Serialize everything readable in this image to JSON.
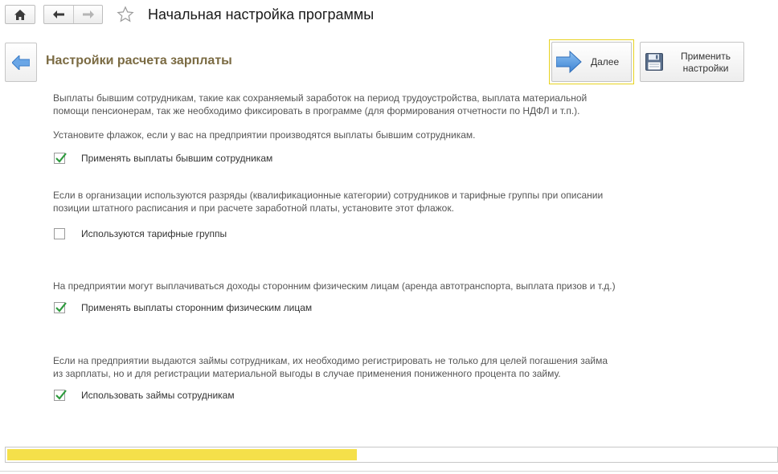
{
  "window": {
    "title": "Начальная настройка программы"
  },
  "header": {
    "section_title": "Настройки расчета зарплаты",
    "next_label": "Далее",
    "apply_label_line1": "Применить",
    "apply_label_line2": "настройки"
  },
  "sections": [
    {
      "text_lines": [
        "Выплаты бывшим сотрудникам, такие как сохраняемый заработок на период трудоустройства, выплата материальной",
        "помощи пенсионерам, так же необходимо фиксировать в программе (для формирования отчетности по НДФЛ и т.п.)."
      ],
      "hint": "Установите флажок, если у вас на предприятии производятся выплаты бывшим сотрудникам.",
      "checkbox_label": "Применять выплаты бывшим сотрудникам",
      "checked": true
    },
    {
      "text_lines": [
        "Если в организации используются разряды (квалификационные категории) сотрудников и тарифные группы при описании",
        "позиции штатного расписания и при расчете заработной платы, установите этот флажок."
      ],
      "checkbox_label": "Используются тарифные группы",
      "checked": false
    },
    {
      "text_lines": [
        "На предприятии могут выплачиваться доходы сторонним физическим лицам (аренда автотранспорта, выплата призов и т.д.)"
      ],
      "checkbox_label": "Применять выплаты сторонним физическим лицам",
      "checked": true
    },
    {
      "text_lines": [
        "Если на предприятии выдаются займы сотрудникам, их необходимо регистрировать не только для целей погашения займа",
        "из зарплаты, но и для регистрации материальной выгоды в случае применения пониженного процента по займу."
      ],
      "checkbox_label": "Использовать займы сотрудникам",
      "checked": true
    }
  ],
  "progress": {
    "fraction": 0.455
  },
  "colors": {
    "accent_title": "#7b6b43",
    "check_green": "#2e9b3e",
    "progress_yellow": "#f5e04a",
    "next_arrow_blue": "#4a8fd8"
  }
}
